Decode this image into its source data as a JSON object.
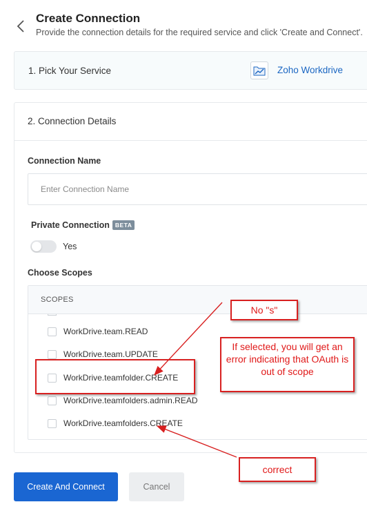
{
  "header": {
    "title": "Create Connection",
    "subtitle": "Provide the connection details for the required service and click 'Create and Connect'."
  },
  "service_card": {
    "label": "1. Pick Your Service",
    "service_name": "Zoho Workdrive",
    "service_icon": "workdrive-icon"
  },
  "details_card": {
    "label": "2. Connection Details",
    "connection_name_label": "Connection Name",
    "connection_name_placeholder": "Enter Connection Name",
    "connection_name_value": "",
    "private_label": "Private Connection",
    "beta_badge": "BETA",
    "toggle_label": "Yes",
    "toggle_on": false,
    "scopes_label": "Choose Scopes",
    "scopes_header": "SCOPES",
    "scopes": [
      {
        "label": "WorkDrive.team.READ",
        "checked": false
      },
      {
        "label": "WorkDrive.team.UPDATE",
        "checked": false
      },
      {
        "label": "WorkDrive.teamfolder.CREATE",
        "checked": false
      },
      {
        "label": "WorkDrive.teamfolders.admin.READ",
        "checked": false
      },
      {
        "label": "WorkDrive.teamfolders.CREATE",
        "checked": false
      }
    ]
  },
  "actions": {
    "create": "Create And Connect",
    "cancel": "Cancel"
  },
  "annotations": {
    "no_s": "No \"s\"",
    "error_note": "If selected, you will get an error indicating that OAuth is out of scope",
    "correct": "correct"
  },
  "colors": {
    "primary": "#1a66d2",
    "annotation_red": "#d82020",
    "link_blue": "#1a66c2"
  }
}
